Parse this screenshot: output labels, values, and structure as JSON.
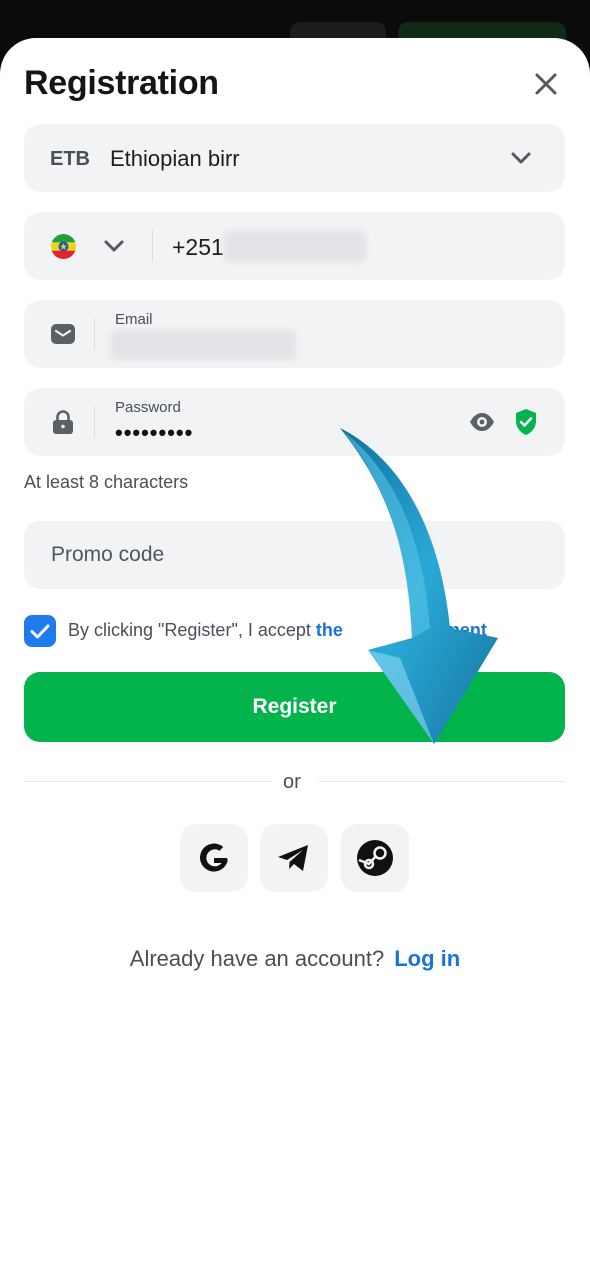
{
  "dialog": {
    "title": "Registration",
    "close_icon": "close-icon"
  },
  "currency": {
    "code": "ETB",
    "name": "Ethiopian birr",
    "icon": "chevron-down-icon"
  },
  "phone": {
    "country_icon": "ethiopia-flag-icon",
    "dial_code": "+251"
  },
  "email": {
    "label": "Email",
    "icon": "envelope-icon"
  },
  "password": {
    "label": "Password",
    "value_masked": "•••••••••",
    "hint": "At least 8 characters",
    "icons": [
      "lock-icon",
      "eye-icon",
      "shield-check-icon"
    ]
  },
  "promo": {
    "placeholder": "Promo code"
  },
  "agreement": {
    "checked": true,
    "text": "By clicking \"Register\", I accept ",
    "link_start": "the",
    "link_end": "ment"
  },
  "register": {
    "label": "Register"
  },
  "divider": {
    "label": "or"
  },
  "social": [
    "google-icon",
    "telegram-icon",
    "steam-icon"
  ],
  "footer": {
    "question": "Already have an account?",
    "login_label": "Log in"
  },
  "colors": {
    "accent_green": "#03b44d",
    "link_blue": "#1a73d9",
    "checkbox_blue": "#1f7aec",
    "field_bg": "#f2f3f5",
    "arrow_blue": "#1a9bc8"
  }
}
